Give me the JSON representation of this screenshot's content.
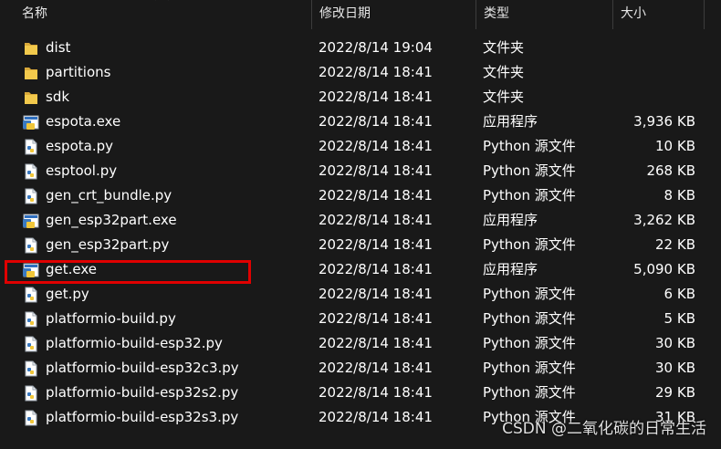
{
  "columns": {
    "name": "名称",
    "modified": "修改日期",
    "type": "类型",
    "size": "大小"
  },
  "files": [
    {
      "name": "dist",
      "date": "2022/8/14 19:04",
      "type": "文件夹",
      "size": "",
      "icon": "folder-icon"
    },
    {
      "name": "partitions",
      "date": "2022/8/14 18:41",
      "type": "文件夹",
      "size": "",
      "icon": "folder-icon"
    },
    {
      "name": "sdk",
      "date": "2022/8/14 18:41",
      "type": "文件夹",
      "size": "",
      "icon": "folder-icon"
    },
    {
      "name": "espota.exe",
      "date": "2022/8/14 18:41",
      "type": "应用程序",
      "size": "3,936 KB",
      "icon": "exe-icon"
    },
    {
      "name": "espota.py",
      "date": "2022/8/14 18:41",
      "type": "Python 源文件",
      "size": "10 KB",
      "icon": "python-file-icon"
    },
    {
      "name": "esptool.py",
      "date": "2022/8/14 18:41",
      "type": "Python 源文件",
      "size": "268 KB",
      "icon": "python-file-icon"
    },
    {
      "name": "gen_crt_bundle.py",
      "date": "2022/8/14 18:41",
      "type": "Python 源文件",
      "size": "8 KB",
      "icon": "python-file-icon"
    },
    {
      "name": "gen_esp32part.exe",
      "date": "2022/8/14 18:41",
      "type": "应用程序",
      "size": "3,262 KB",
      "icon": "exe-icon"
    },
    {
      "name": "gen_esp32part.py",
      "date": "2022/8/14 18:41",
      "type": "Python 源文件",
      "size": "22 KB",
      "icon": "python-file-icon"
    },
    {
      "name": "get.exe",
      "date": "2022/8/14 18:41",
      "type": "应用程序",
      "size": "5,090 KB",
      "icon": "exe-icon"
    },
    {
      "name": "get.py",
      "date": "2022/8/14 18:41",
      "type": "Python 源文件",
      "size": "6 KB",
      "icon": "python-file-icon"
    },
    {
      "name": "platformio-build.py",
      "date": "2022/8/14 18:41",
      "type": "Python 源文件",
      "size": "5 KB",
      "icon": "python-file-icon"
    },
    {
      "name": "platformio-build-esp32.py",
      "date": "2022/8/14 18:41",
      "type": "Python 源文件",
      "size": "30 KB",
      "icon": "python-file-icon"
    },
    {
      "name": "platformio-build-esp32c3.py",
      "date": "2022/8/14 18:41",
      "type": "Python 源文件",
      "size": "30 KB",
      "icon": "python-file-icon"
    },
    {
      "name": "platformio-build-esp32s2.py",
      "date": "2022/8/14 18:41",
      "type": "Python 源文件",
      "size": "29 KB",
      "icon": "python-file-icon"
    },
    {
      "name": "platformio-build-esp32s3.py",
      "date": "2022/8/14 18:41",
      "type": "Python 源文件",
      "size": "31 KB",
      "icon": "python-file-icon"
    }
  ],
  "watermark": "CSDN @二氧化碳的日常生活",
  "colors": {
    "background": "#191919",
    "highlight": "#e00000",
    "folder": "#f2c94c"
  }
}
